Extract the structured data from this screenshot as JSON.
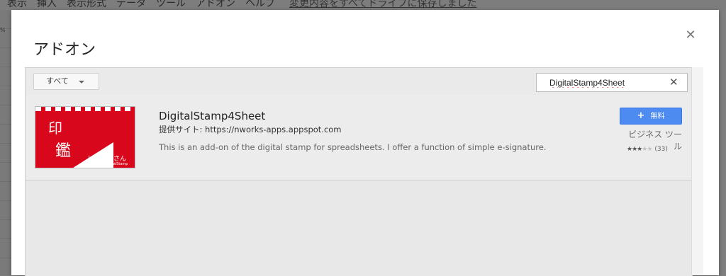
{
  "background_menu": {
    "items": [
      "表示",
      "挿入",
      "表示形式",
      "データ",
      "ツール",
      "アドオン",
      "ヘルプ"
    ],
    "saved_status": "変更内容をすべてドライブに保存しました",
    "percent": "%"
  },
  "dialog": {
    "title": "アドオン",
    "close_icon": "close-icon"
  },
  "toolbar": {
    "filter_label": "すべて",
    "search_value": "DigitalStamp4Sheet",
    "clear_icon": "clear-icon"
  },
  "addon": {
    "name": "DigitalStamp4Sheet",
    "provider": "提供サイト: https://nworks-apps.appspot.com",
    "description": "This is an add-on of the digital stamp for spreadsheets. I offer a function of simple e-signature.",
    "install_label": "無料",
    "category": "ビジネス ツール",
    "rating": 2.5,
    "rating_max": 5,
    "rating_count": "(33)",
    "thumbnail": {
      "kanji_1": "印",
      "kanji_2": "鑑",
      "subtitle": "はんこ屋さん",
      "subtitle_2": "DigitalStamp"
    }
  },
  "colors": {
    "install_button": "#4d8bf0",
    "thumbnail_red": "#d8071c"
  }
}
